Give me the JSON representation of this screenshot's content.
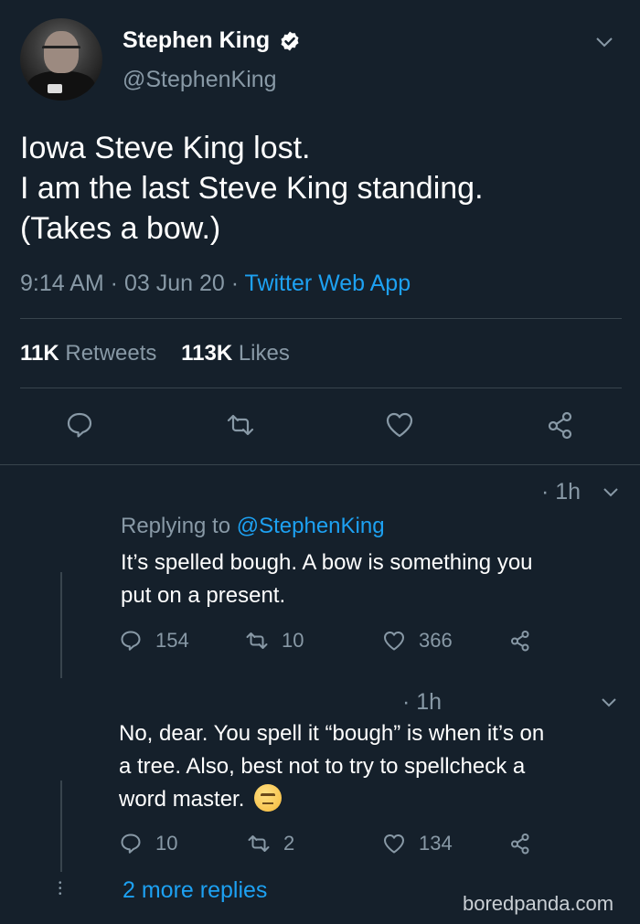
{
  "tweet": {
    "author_name": "Stephen King",
    "handle": "@StephenKing",
    "lines": [
      "Iowa Steve King lost.",
      "I am the last Steve King standing.",
      "(Takes a bow.)"
    ],
    "time": "9:14 AM",
    "date": "03 Jun 20",
    "source": "Twitter Web App",
    "retweets_count": "11K",
    "retweets_label": "Retweets",
    "likes_count": "113K",
    "likes_label": "Likes"
  },
  "replies": [
    {
      "time": "· 1h",
      "replying_prefix": "Replying to",
      "replying_handle": "@StephenKing",
      "lines": [
        "It’s spelled bough. A bow is something you",
        "put on a present."
      ],
      "reply_count": "154",
      "retweet_count": "10",
      "like_count": "366"
    },
    {
      "time": "· 1h",
      "lines": [
        "No, dear. You spell it “bough” is when it’s on",
        "a tree. Also, best not to try to spellcheck a",
        "word master."
      ],
      "reply_count": "10",
      "retweet_count": "2",
      "like_count": "134"
    }
  ],
  "more_replies_label": "2 more replies",
  "watermark": "boredpanda.com",
  "icons": {
    "reply": "reply-icon",
    "retweet": "retweet-icon",
    "like": "heart-icon",
    "share": "share-icon",
    "verified": "verified-badge-icon",
    "chevron": "chevron-down-icon",
    "emoji": "rolling-eyes-emoji-icon"
  },
  "colors": {
    "background": "#15202b",
    "link": "#1da1f2",
    "muted": "#8899a6",
    "divider": "#38444d"
  }
}
